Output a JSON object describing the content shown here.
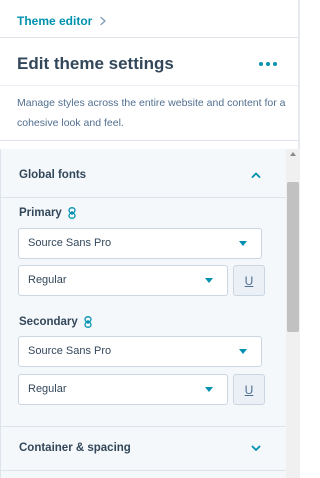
{
  "breadcrumb": {
    "label": "Theme editor"
  },
  "header": {
    "title": "Edit theme settings",
    "description": "Manage styles across the entire website and content for a cohesive look and feel."
  },
  "sections": {
    "global_fonts": {
      "title": "Global fonts",
      "expanded": true
    },
    "container_spacing": {
      "title": "Container & spacing",
      "expanded": false
    }
  },
  "fonts": {
    "primary": {
      "label": "Primary",
      "family": "Source Sans Pro",
      "weight": "Regular",
      "underline": "U"
    },
    "secondary": {
      "label": "Secondary",
      "family": "Source Sans Pro",
      "weight": "Regular",
      "underline": "U"
    }
  },
  "icons": {
    "breadcrumb": "chevron-right-icon",
    "more": "more-options-icon",
    "expanded": "chevron-up-icon",
    "collapsed": "chevron-down-icon",
    "link": "link-icon",
    "caret": "caret-down-icon"
  },
  "colors": {
    "accent": "#0091ae",
    "text": "#33475b",
    "panel_bg": "#f5f8fa",
    "border": "#cbd6e2"
  }
}
